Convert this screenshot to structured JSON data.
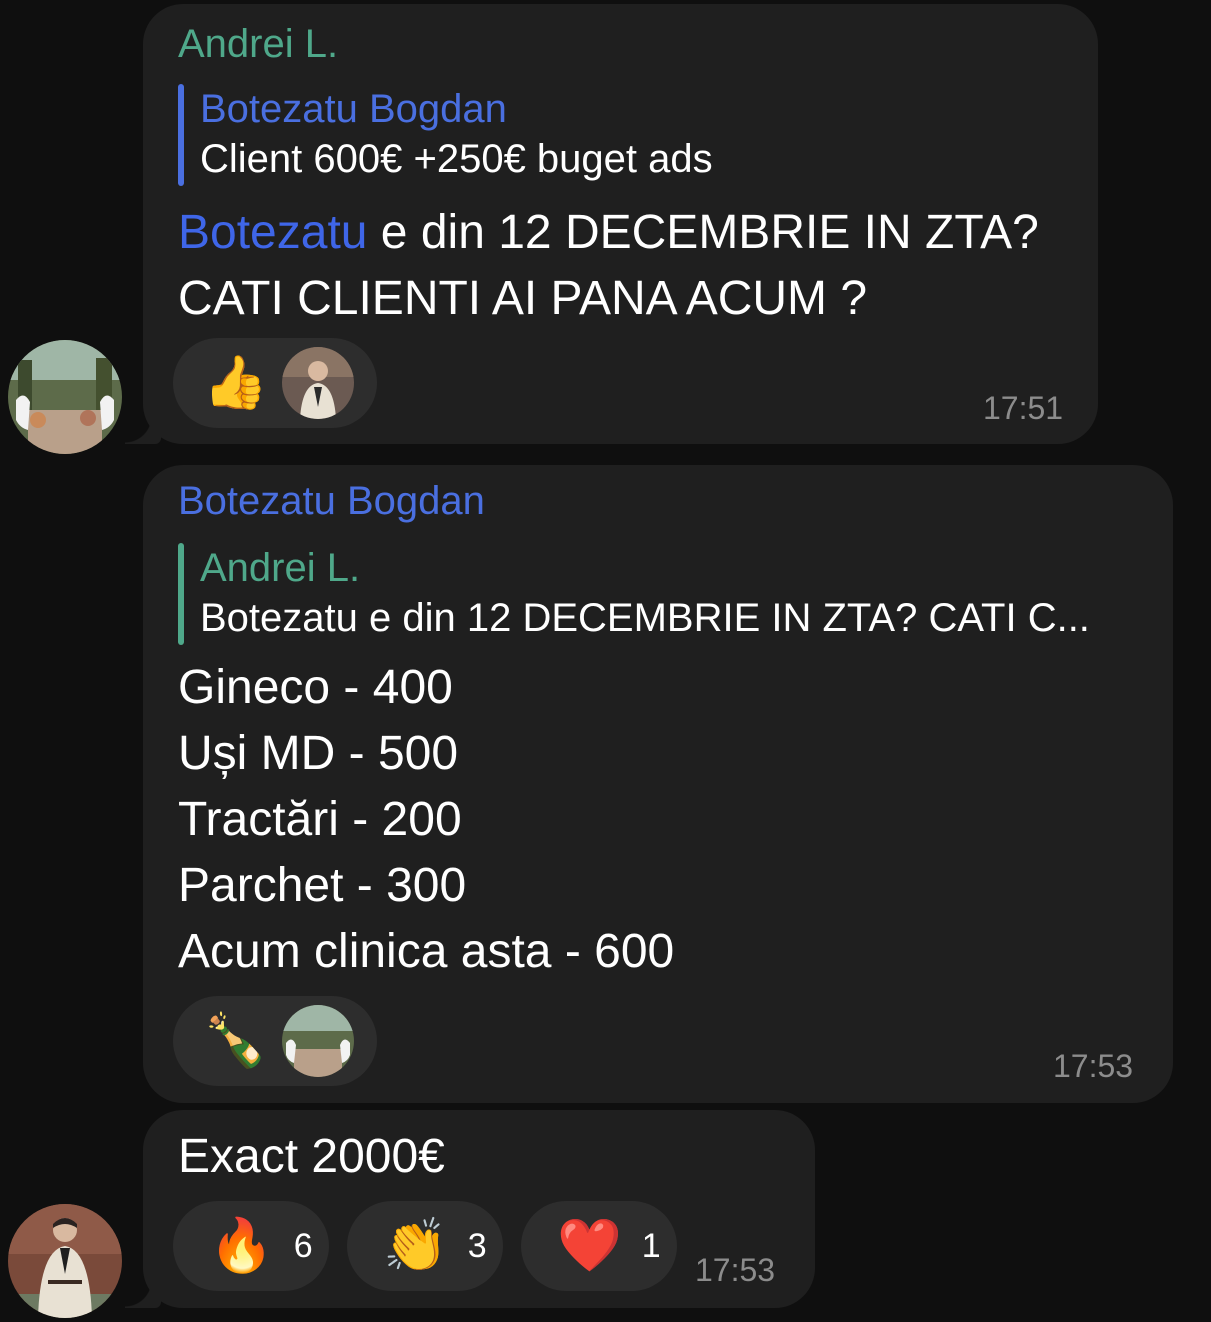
{
  "messages": [
    {
      "sender": "Andrei L.",
      "reply": {
        "name": "Botezatu Bogdan",
        "text": "Client 600€  +250€ buget ads"
      },
      "mention": "Botezatu",
      "line1_rest": " e din 12 DECEMBRIE IN ZTA?",
      "line2": "CATI CLIENTI AI PANA ACUM ?",
      "reactions": [
        {
          "emoji": "👍",
          "icon": "thumbs-up-icon"
        }
      ],
      "time": "17:51"
    },
    {
      "sender": "Botezatu Bogdan",
      "reply": {
        "name": "Andrei L.",
        "text": "Botezatu  e din 12 DECEMBRIE IN ZTA? CATI C..."
      },
      "lines": [
        "Gineco - 400",
        "Uși MD - 500",
        "Tractări - 200",
        "Parchet - 300",
        "Acum clinica asta - 600"
      ],
      "reactions": [
        {
          "emoji": "🍾",
          "icon": "champagne-icon"
        }
      ],
      "time": "17:53"
    },
    {
      "text": "Exact 2000€",
      "reactions": [
        {
          "emoji": "🔥",
          "count": "6",
          "icon": "fire-icon"
        },
        {
          "emoji": "👏",
          "count": "3",
          "icon": "clapping-hands-icon"
        },
        {
          "emoji": "❤️",
          "count": "1",
          "icon": "heart-icon"
        }
      ],
      "time": "17:53"
    }
  ],
  "colors": {
    "bubble": "#1f1f1f",
    "background": "#0f0f0f",
    "green_name": "#4fa88a",
    "blue_name": "#4a6fe0",
    "timestamp": "#8c8c8c"
  }
}
